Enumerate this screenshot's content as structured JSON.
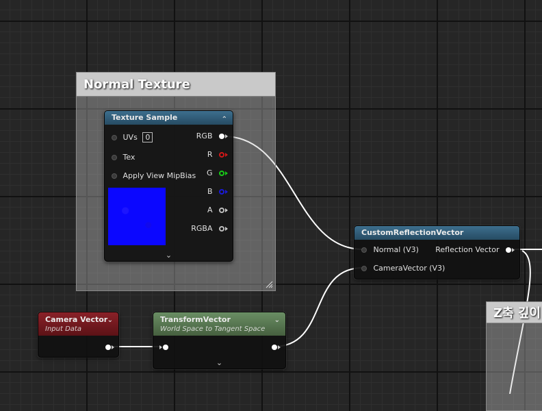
{
  "comments": {
    "normal_texture": "Normal Texture",
    "z_depth": "Z축 깊이"
  },
  "texture_sample": {
    "title": "Texture Sample",
    "inputs": {
      "uvs": "UVs",
      "uvs_value": "0",
      "tex": "Tex",
      "mipbias": "Apply View MipBias"
    },
    "outputs": {
      "rgb": "RGB",
      "r": "R",
      "g": "G",
      "b": "B",
      "a": "A",
      "rgba": "RGBA"
    },
    "preview_color": "#0b07ff"
  },
  "custom_reflection": {
    "title": "CustomReflectionVector",
    "inputs": {
      "normal": "Normal (V3)",
      "camera": "CameraVector (V3)"
    },
    "output": "Reflection Vector"
  },
  "camera_vector": {
    "title": "Camera Vector",
    "subtitle": "Input Data"
  },
  "transform_vector": {
    "title": "TransformVector",
    "subtitle": "World Space to Tangent Space"
  },
  "colors": {
    "wire": "#ffffff",
    "header_blue": "#3d6f8e",
    "header_red": "#8a2128",
    "header_green": "#6a8e64"
  }
}
